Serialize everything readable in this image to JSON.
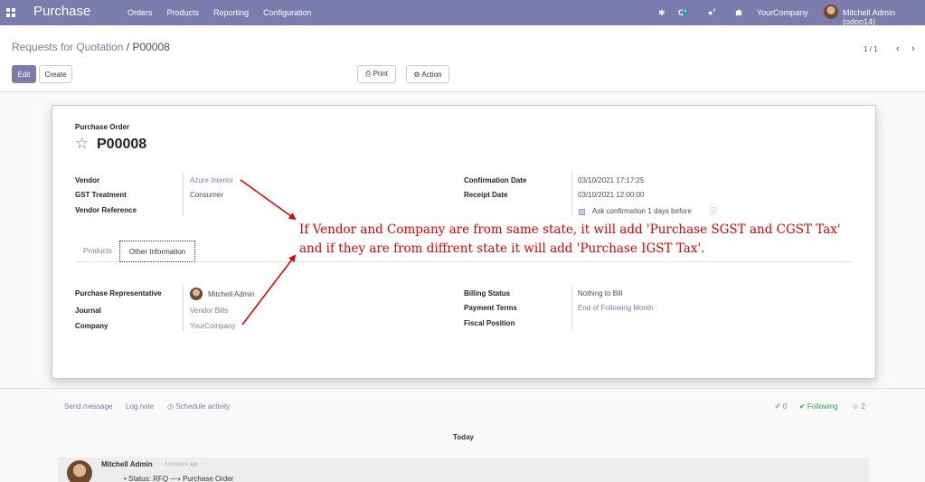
{
  "topbar": {
    "app_name": "Purchase",
    "menu": [
      "Orders",
      "Products",
      "Reporting",
      "Configuration"
    ],
    "bug_icon": "✱",
    "activity_icon": "C",
    "activity_count": "4",
    "chat_icon": "●",
    "chat_count": "4",
    "gift_icon": "☗",
    "company": "YourCompany",
    "user": "Mitchell Admin (odoo14)"
  },
  "breadcrumb": {
    "parent": "Requests for Quotation",
    "separator": "/",
    "current": "P00008"
  },
  "toolbar": {
    "edit": "Edit",
    "create": "Create",
    "print": "⎙ Print",
    "action": "⚙ Action"
  },
  "pager": {
    "value": "1 / 1",
    "prev": "‹",
    "next": "›"
  },
  "form": {
    "doc_type": "Purchase Order",
    "star_icon": "☆",
    "name": "P00008",
    "left_fields": [
      {
        "label": "Vendor",
        "value": "Azure Interior"
      },
      {
        "label": "GST Treatment",
        "value": "Consumer"
      },
      {
        "label": "Vendor Reference",
        "value": ""
      }
    ],
    "right_fields": [
      {
        "label": "Confirmation Date",
        "value": "03/10/2021 17:17:25"
      },
      {
        "label": "Receipt Date",
        "value": "03/10/2021 12:00:00"
      }
    ],
    "ask_confirmation": {
      "prefix": "Ask confirmation",
      "days": "1",
      "suffix": "days before",
      "info_icon": "ⓘ"
    },
    "tabs": [
      "Products",
      "Other Information"
    ],
    "other_left": [
      {
        "label": "Purchase Representative",
        "value": "Mitchell Admin"
      },
      {
        "label": "Journal",
        "value": "Vendor Bills"
      },
      {
        "label": "Company",
        "value": "YourCompany"
      }
    ],
    "other_right": [
      {
        "label": "Billing Status",
        "value": "Nothing to Bill"
      },
      {
        "label": "Payment Terms",
        "value": "End of Following Month"
      },
      {
        "label": "Fiscal Position",
        "value": ""
      }
    ]
  },
  "annotation": {
    "line1": "If Vendor and Company are from same state, it will add 'Purchase SGST and CGST Tax'",
    "line2": "and if they are from diffrent state it will add 'Purchase IGST Tax'."
  },
  "chatter": {
    "send_message": "Send message",
    "log_note": "Log note",
    "schedule_activity": "◷ Schedule activity",
    "attachments": "✐ 0",
    "following": "✔ Following",
    "followers": "☺ 2",
    "today": "Today",
    "message": {
      "author": "Mitchell Admin",
      "time": "- 3 minutes ago",
      "status_label": "Status: RFQ",
      "arrow": "⟶",
      "status_new": "Purchase Order"
    }
  },
  "colors": {
    "brand": "#7c7bad",
    "annotation": "#dd0000",
    "following": "#28a745"
  }
}
